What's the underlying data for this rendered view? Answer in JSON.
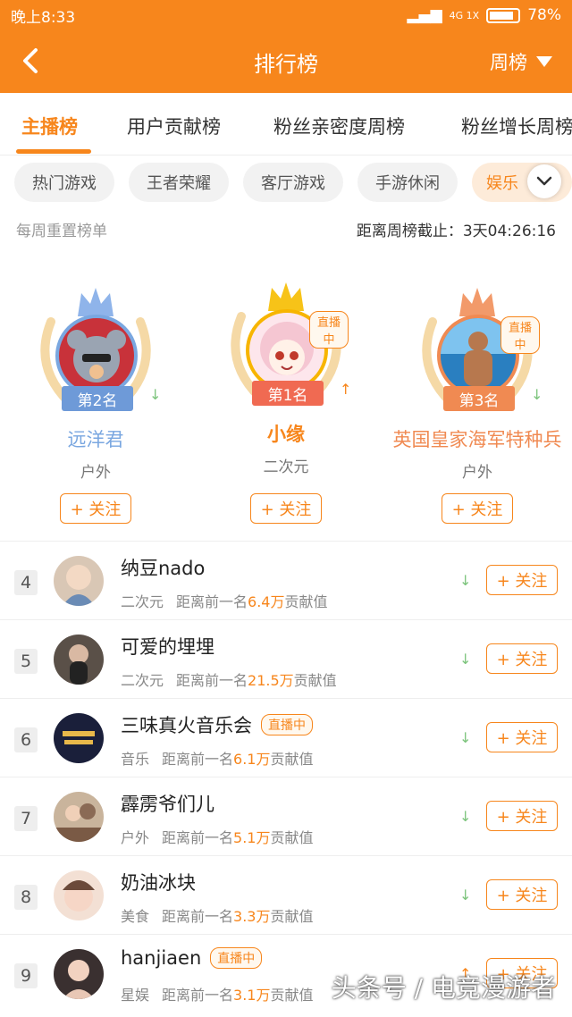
{
  "status": {
    "time": "晚上8:33",
    "network": "4G 1X",
    "battery": "78%"
  },
  "nav": {
    "title": "排行榜",
    "period": "周榜"
  },
  "tabs": [
    {
      "label": "主播榜",
      "active": true
    },
    {
      "label": "用户贡献榜",
      "active": false
    },
    {
      "label": "粉丝亲密度周榜",
      "active": false
    },
    {
      "label": "粉丝增长周榜",
      "active": false
    }
  ],
  "categories": [
    "热门游戏",
    "王者荣耀",
    "客厅游戏",
    "手游休闲",
    "娱乐"
  ],
  "meta": {
    "left": "每周重置榜单",
    "right": "距离周榜截止：3天04:26:16"
  },
  "top3": [
    {
      "rank": "第2名",
      "name": "远洋君",
      "category": "户外",
      "follow": "+ 关注",
      "trend": "down",
      "live": ""
    },
    {
      "rank": "第1名",
      "name": "小缘",
      "category": "二次元",
      "follow": "+ 关注",
      "trend": "up",
      "live": "直播中"
    },
    {
      "rank": "第3名",
      "name": "英国皇家海军特种兵",
      "category": "户外",
      "follow": "+ 关注",
      "trend": "down",
      "live": "直播中"
    }
  ],
  "rows": [
    {
      "num": "4",
      "name": "纳豆nado",
      "live": "",
      "category": "二次元",
      "gap_prefix": "距离前一名",
      "gap": "6.4万",
      "gap_suffix": "贡献值",
      "trend": "down",
      "follow": "+ 关注"
    },
    {
      "num": "5",
      "name": "可爱的埋埋",
      "live": "",
      "category": "二次元",
      "gap_prefix": "距离前一名",
      "gap": "21.5万",
      "gap_suffix": "贡献值",
      "trend": "down",
      "follow": "+ 关注"
    },
    {
      "num": "6",
      "name": "三味真火音乐会",
      "live": "直播中",
      "category": "音乐",
      "gap_prefix": "距离前一名",
      "gap": "6.1万",
      "gap_suffix": "贡献值",
      "trend": "down",
      "follow": "+ 关注"
    },
    {
      "num": "7",
      "name": "霹雳爷们儿",
      "live": "",
      "category": "户外",
      "gap_prefix": "距离前一名",
      "gap": "5.1万",
      "gap_suffix": "贡献值",
      "trend": "down",
      "follow": "+ 关注"
    },
    {
      "num": "8",
      "name": "奶油冰块",
      "live": "",
      "category": "美食",
      "gap_prefix": "距离前一名",
      "gap": "3.3万",
      "gap_suffix": "贡献值",
      "trend": "down",
      "follow": "+ 关注"
    },
    {
      "num": "9",
      "name": "hanjiaen",
      "live": "直播中",
      "category": "星娱",
      "gap_prefix": "距离前一名",
      "gap": "3.1万",
      "gap_suffix": "贡献值",
      "trend": "up",
      "follow": "+ 关注"
    }
  ],
  "watermark": "头条号 / 电竞漫游者",
  "colors": {
    "accent": "#f7861c",
    "silver": "#7aa7e0",
    "gold": "#f7b500",
    "bronze": "#f08a52",
    "trend_up": "#f7861c",
    "trend_down": "#7cc47c"
  }
}
